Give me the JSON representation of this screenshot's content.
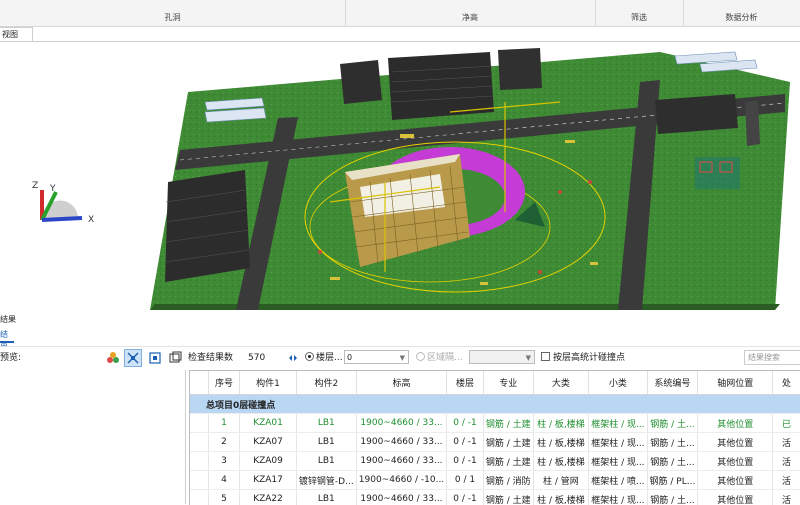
{
  "ribbon": {
    "groups": [
      "孔洞",
      "净高",
      "筛选",
      "数据分析"
    ]
  },
  "view_tab": "视图",
  "axis": {
    "z": "Z",
    "y": "Y",
    "x": "X"
  },
  "panel": {
    "title": "结果",
    "subtab": "结果"
  },
  "toolbar": {
    "preview_label": "预览:",
    "count_label": "检查结果数",
    "count_value": "570",
    "floor_radio": "楼层...",
    "floor_value": "0",
    "zone_radio": "区域隔...",
    "zone_value": "",
    "checkbox_label": "按层高统计碰撞点",
    "search_placeholder": "结果搜索"
  },
  "table": {
    "headers": [
      "序号",
      "构件1",
      "构件2",
      "标高",
      "楼层",
      "专业",
      "大类",
      "小类",
      "系统编号",
      "轴网位置",
      "处"
    ],
    "group_label": "总项目0层碰撞点",
    "rows": [
      {
        "cells": [
          "1",
          "KZA01",
          "LB1",
          "1900~4660 / 33...",
          "0 / -1",
          "钢筋 / 土建",
          "柱 / 板,楼梯",
          "框架柱 / 现...",
          "钢筋 / 土...",
          "其他位置",
          "已"
        ],
        "selected": true
      },
      {
        "cells": [
          "2",
          "KZA07",
          "LB1",
          "1900~4660 / 33...",
          "0 / -1",
          "钢筋 / 土建",
          "柱 / 板,楼梯",
          "框架柱 / 现...",
          "钢筋 / 土...",
          "其他位置",
          "活"
        ],
        "selected": false
      },
      {
        "cells": [
          "3",
          "KZA09",
          "LB1",
          "1900~4660 / 33...",
          "0 / -1",
          "钢筋 / 土建",
          "柱 / 板,楼梯",
          "框架柱 / 现...",
          "钢筋 / 土...",
          "其他位置",
          "活"
        ],
        "selected": false
      },
      {
        "cells": [
          "4",
          "KZA17",
          "镀锌钢管-D...",
          "1900~4660 / -10...",
          "0 / 1",
          "钢筋 / 消防",
          "柱 / 管网",
          "框架柱 / 喷...",
          "钢筋 / PL...",
          "其他位置",
          "活"
        ],
        "selected": false
      },
      {
        "cells": [
          "5",
          "KZA22",
          "LB1",
          "1900~4660 / 33...",
          "0 / -1",
          "钢筋 / 土建",
          "柱 / 板,楼梯",
          "框架柱 / 现...",
          "钢筋 / 土...",
          "其他位置",
          "活"
        ],
        "selected": false
      }
    ]
  },
  "colors": {
    "site_green": "#3f8a34",
    "road": "#3a3a3a",
    "selection": "#c43bd6",
    "group_row": "#b9d7f3",
    "selected_text": "#1f8f2f"
  }
}
